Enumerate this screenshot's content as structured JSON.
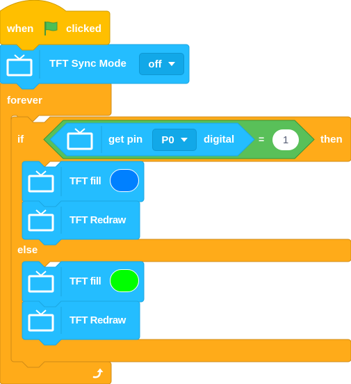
{
  "colors": {
    "events": "#ffbf00",
    "control": "#ffab19",
    "control_border": "#cf8b17",
    "tft": "#24bdff",
    "tft_border": "#1ca6e0",
    "operator": "#59c059",
    "operator_border": "#389438",
    "flag": "#4cbf56"
  },
  "script": {
    "hat": {
      "when_label": "when",
      "flag_icon": "green-flag-icon",
      "clicked_label": "clicked"
    },
    "sync_mode": {
      "label": "TFT Sync Mode",
      "dropdown_value": "off",
      "icon": "tv-icon"
    },
    "forever": {
      "label": "forever",
      "loop_icon": "loop-arrow-icon"
    },
    "if_else": {
      "if_label": "if",
      "then_label": "then",
      "else_label": "else",
      "condition": {
        "reporter_label": "get pin",
        "pin_value": "P0",
        "mode_label": "digital",
        "operator": "=",
        "compare_value": "1"
      },
      "then_blocks": [
        {
          "label": "TFT fill",
          "color": "#0080ff"
        },
        {
          "label": "TFT Redraw"
        }
      ],
      "else_blocks": [
        {
          "label": "TFT fill",
          "color": "#00ff00"
        },
        {
          "label": "TFT Redraw"
        }
      ]
    }
  }
}
